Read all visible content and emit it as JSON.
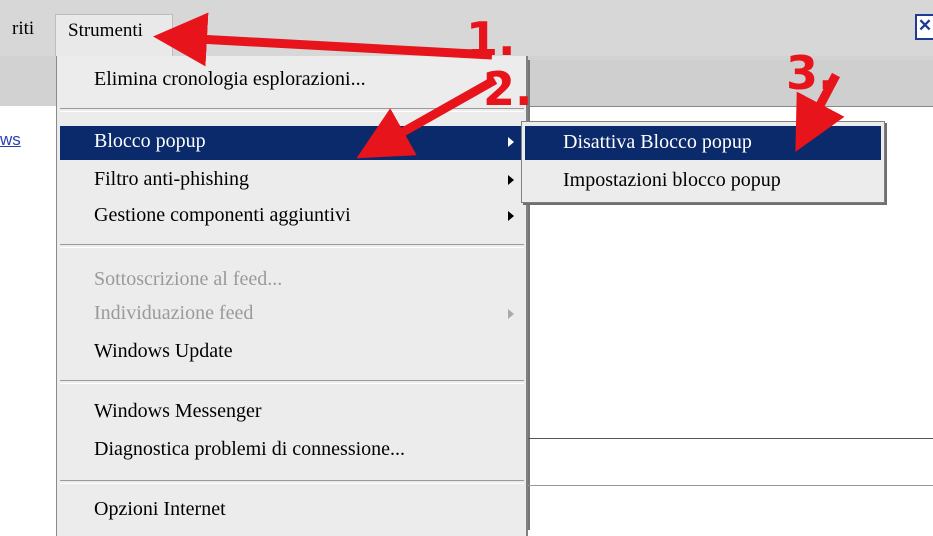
{
  "menubar": {
    "partial_menu_label": "riti",
    "tools_menu_label": "Strumenti",
    "close_icon": "close-icon"
  },
  "background": {
    "partial_link_text": "ws"
  },
  "tools_menu": {
    "items": [
      {
        "label": "Elimina cronologia esplorazioni...",
        "enabled": true,
        "submenu": false
      },
      {
        "label": "Blocco popup",
        "enabled": true,
        "submenu": true,
        "selected": true
      },
      {
        "label": "Filtro anti-phishing",
        "enabled": true,
        "submenu": true
      },
      {
        "label": "Gestione componenti aggiuntivi",
        "enabled": true,
        "submenu": true
      },
      {
        "label": "Sottoscrizione al feed...",
        "enabled": false,
        "submenu": false
      },
      {
        "label": "Individuazione feed",
        "enabled": false,
        "submenu": true
      },
      {
        "label": "Windows Update",
        "enabled": true,
        "submenu": false
      },
      {
        "label": "Windows Messenger",
        "enabled": true,
        "submenu": false
      },
      {
        "label": "Diagnostica problemi di connessione...",
        "enabled": true,
        "submenu": false
      },
      {
        "label": "Opzioni Internet",
        "enabled": true,
        "submenu": false
      }
    ]
  },
  "popup_submenu": {
    "items": [
      {
        "label": "Disattiva Blocco popup",
        "selected": true
      },
      {
        "label": "Impostazioni blocco popup",
        "selected": false
      }
    ]
  },
  "annotations": {
    "step1": "1.",
    "step2": "2.",
    "step3": "3.",
    "color": "#e8141b"
  },
  "colors": {
    "highlight": "#0b2a6b",
    "menu_bg": "#ececec",
    "disabled_text": "#9a9a9a"
  }
}
